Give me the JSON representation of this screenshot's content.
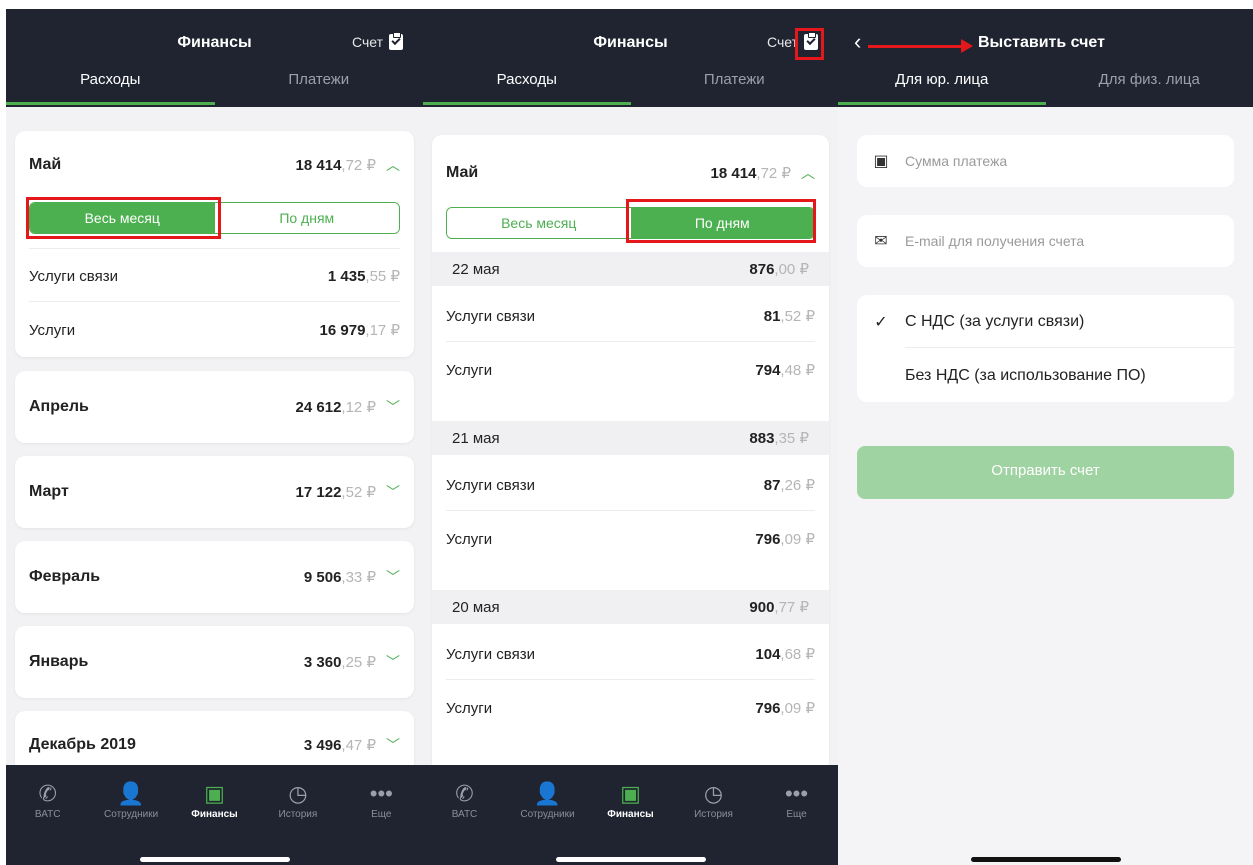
{
  "colors": {
    "dark": "#1f2430",
    "accent": "#4caf50",
    "highlight": "#e4181a",
    "disabled_btn": "#9fd4a2"
  },
  "screen1": {
    "title": "Финансы",
    "invoice_label": "Счет",
    "tabs": [
      "Расходы",
      "Платежи"
    ],
    "may": {
      "name": "Май",
      "int": "18 414",
      "cents": ",72 ₽"
    },
    "segments": [
      "Весь месяц",
      "По дням"
    ],
    "services": [
      {
        "label": "Услуги связи",
        "int": "1 435",
        "cents": ",55 ₽"
      },
      {
        "label": "Услуги",
        "int": "16 979",
        "cents": ",17 ₽"
      }
    ],
    "months": [
      {
        "name": "Апрель",
        "int": "24 612",
        "cents": ",12 ₽"
      },
      {
        "name": "Март",
        "int": "17 122",
        "cents": ",52 ₽"
      },
      {
        "name": "Февраль",
        "int": "9 506",
        "cents": ",33 ₽"
      },
      {
        "name": "Январь",
        "int": "3 360",
        "cents": ",25 ₽"
      },
      {
        "name": "Декабрь 2019",
        "int": "3 496",
        "cents": ",47 ₽"
      }
    ]
  },
  "screen2": {
    "title": "Финансы",
    "invoice_label": "Счет",
    "tabs": [
      "Расходы",
      "Платежи"
    ],
    "may": {
      "name": "Май",
      "int": "18 414",
      "cents": ",72 ₽"
    },
    "segments": [
      "Весь месяц",
      "По дням"
    ],
    "days": [
      {
        "date": "22 мая",
        "int": "876",
        "cents": ",00 ₽",
        "items": [
          {
            "label": "Услуги связи",
            "int": "81",
            "cents": ",52 ₽"
          },
          {
            "label": "Услуги",
            "int": "794",
            "cents": ",48 ₽"
          }
        ]
      },
      {
        "date": "21 мая",
        "int": "883",
        "cents": ",35 ₽",
        "items": [
          {
            "label": "Услуги связи",
            "int": "87",
            "cents": ",26 ₽"
          },
          {
            "label": "Услуги",
            "int": "796",
            "cents": ",09 ₽"
          }
        ]
      },
      {
        "date": "20 мая",
        "int": "900",
        "cents": ",77 ₽",
        "items": [
          {
            "label": "Услуги связи",
            "int": "104",
            "cents": ",68 ₽"
          },
          {
            "label": "Услуги",
            "int": "796",
            "cents": ",09 ₽"
          }
        ]
      }
    ]
  },
  "bottom_nav": [
    {
      "label": "ВАТС",
      "icon": "phone-icon"
    },
    {
      "label": "Сотрудники",
      "icon": "person-icon"
    },
    {
      "label": "Финансы",
      "icon": "wallet-icon"
    },
    {
      "label": "История",
      "icon": "clock-icon"
    },
    {
      "label": "Еще",
      "icon": "more-icon"
    }
  ],
  "screen3": {
    "back_icon": "chevron-left-icon",
    "title": "Выставить счет",
    "tabs": [
      "Для юр. лица",
      "Для физ. лица"
    ],
    "amount_placeholder": "Сумма платежа",
    "email_placeholder": "E-mail для получения счета",
    "options": [
      "С НДС (за услуги связи)",
      "Без НДС (за использование ПО)"
    ],
    "selected_option": 0,
    "send_label": "Отправить счет"
  }
}
